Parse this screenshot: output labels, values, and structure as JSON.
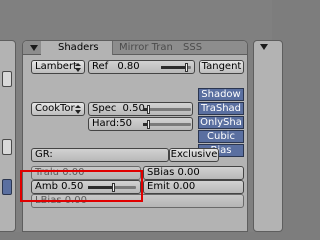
{
  "tabs": [
    {
      "label": "Shaders",
      "active": true
    },
    {
      "label": "Mirror Tran",
      "active": false
    },
    {
      "label": "SSS",
      "active": false
    }
  ],
  "diffuse": {
    "shader": "Lambert",
    "ref_label": "Ref",
    "ref_value": "0.80",
    "ref_level": 0.8,
    "tangent_label": "Tangent"
  },
  "specular": {
    "shader": "CookTor",
    "spec_label": "Spec",
    "spec_value": "0.50",
    "spec_level": 0.25,
    "hard_label": "Hard:",
    "hard_value": "50",
    "hard_level": 0.1
  },
  "shadow_stack": [
    {
      "label": "Shadow",
      "on": true
    },
    {
      "label": "TraShad",
      "on": true
    },
    {
      "label": "OnlySha",
      "on": true
    },
    {
      "label": "Cubic",
      "on": true
    },
    {
      "label": "Bias",
      "on": true
    }
  ],
  "group": {
    "label": "GR:",
    "exclusive_label": "Exclusive"
  },
  "translucency": {
    "label": "Tralu",
    "value": "0.00"
  },
  "sss_bias": {
    "label": "SBias",
    "value": "0.00"
  },
  "amb": {
    "label": "Amb",
    "value": "0.50",
    "level": 0.5
  },
  "emit": {
    "label": "Emit",
    "value": "0.00"
  },
  "lbias": {
    "label": "LBias",
    "value": "0.00"
  },
  "colors": {
    "active_blue": "#5a6fa0",
    "panel": "#b3b3b3",
    "highlight": "#e00000"
  }
}
